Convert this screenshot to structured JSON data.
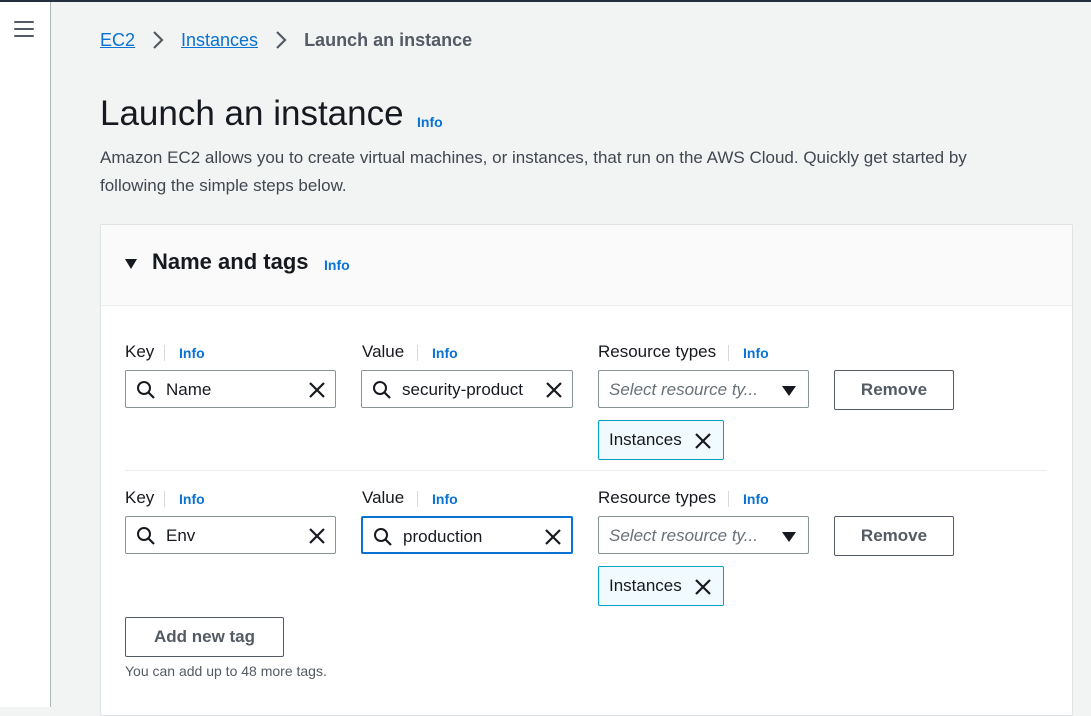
{
  "nav": {
    "menu_icon": "hamburger-menu-icon"
  },
  "breadcrumb": {
    "items": [
      "EC2",
      "Instances"
    ],
    "current": "Launch an instance"
  },
  "page": {
    "title": "Launch an instance",
    "info": "Info",
    "description": "Amazon EC2 allows you to create virtual machines, or instances, that run on the AWS Cloud. Quickly get started by following the simple steps below."
  },
  "panel": {
    "title": "Name and tags",
    "info": "Info",
    "tags": [
      {
        "key_label": "Key",
        "key_info": "Info",
        "key_value": "Name",
        "value_label": "Value",
        "value_info": "Info",
        "value_value": "security-product",
        "resource_label": "Resource types",
        "resource_info": "Info",
        "resource_placeholder": "Select resource ty...",
        "token": "Instances",
        "remove_label": "Remove"
      },
      {
        "key_label": "Key",
        "key_info": "Info",
        "key_value": "Env",
        "value_label": "Value",
        "value_info": "Info",
        "value_value": "production",
        "resource_label": "Resource types",
        "resource_info": "Info",
        "resource_placeholder": "Select resource ty...",
        "token": "Instances",
        "remove_label": "Remove"
      }
    ],
    "add_tag_label": "Add new tag",
    "hint": "You can add up to 48 more tags."
  },
  "colors": {
    "link": "#0972d3",
    "focus": "#0972d3",
    "token_bg": "#f1faff",
    "token_border": "#00a1c9"
  }
}
